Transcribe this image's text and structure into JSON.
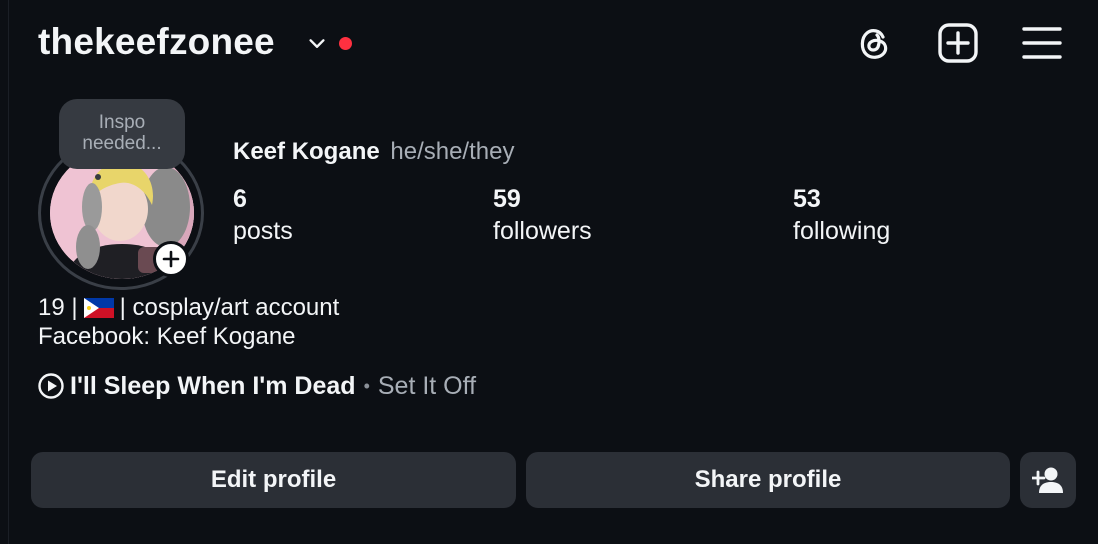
{
  "header": {
    "username": "thekeefzonee",
    "icons": [
      "chevron-down-icon",
      "threads-icon",
      "new-post-icon",
      "menu-icon"
    ],
    "notification_dot_color": "#ff3040"
  },
  "note": {
    "line1": "Inspo",
    "line2": "needed..."
  },
  "profile": {
    "full_name": "Keef Kogane",
    "pronouns": "he/she/they"
  },
  "stats": [
    {
      "value": "6",
      "label": "posts"
    },
    {
      "value": "59",
      "label": "followers"
    },
    {
      "value": "53",
      "label": "following"
    }
  ],
  "bio": {
    "line1_prefix": "19 |",
    "line1_flag": "philippines-flag-icon",
    "line1_suffix": "| cosplay/art account",
    "line2": "Facebook: Keef Kogane"
  },
  "music": {
    "song": "I'll Sleep When I'm Dead",
    "separator": "•",
    "artist": "Set It Off"
  },
  "actions": {
    "edit_label": "Edit profile",
    "share_label": "Share profile",
    "add_icon": "add-person-icon"
  },
  "colors": {
    "background": "#0c0f14",
    "button": "#2b2f36",
    "secondary_text": "#a8aeb6"
  }
}
